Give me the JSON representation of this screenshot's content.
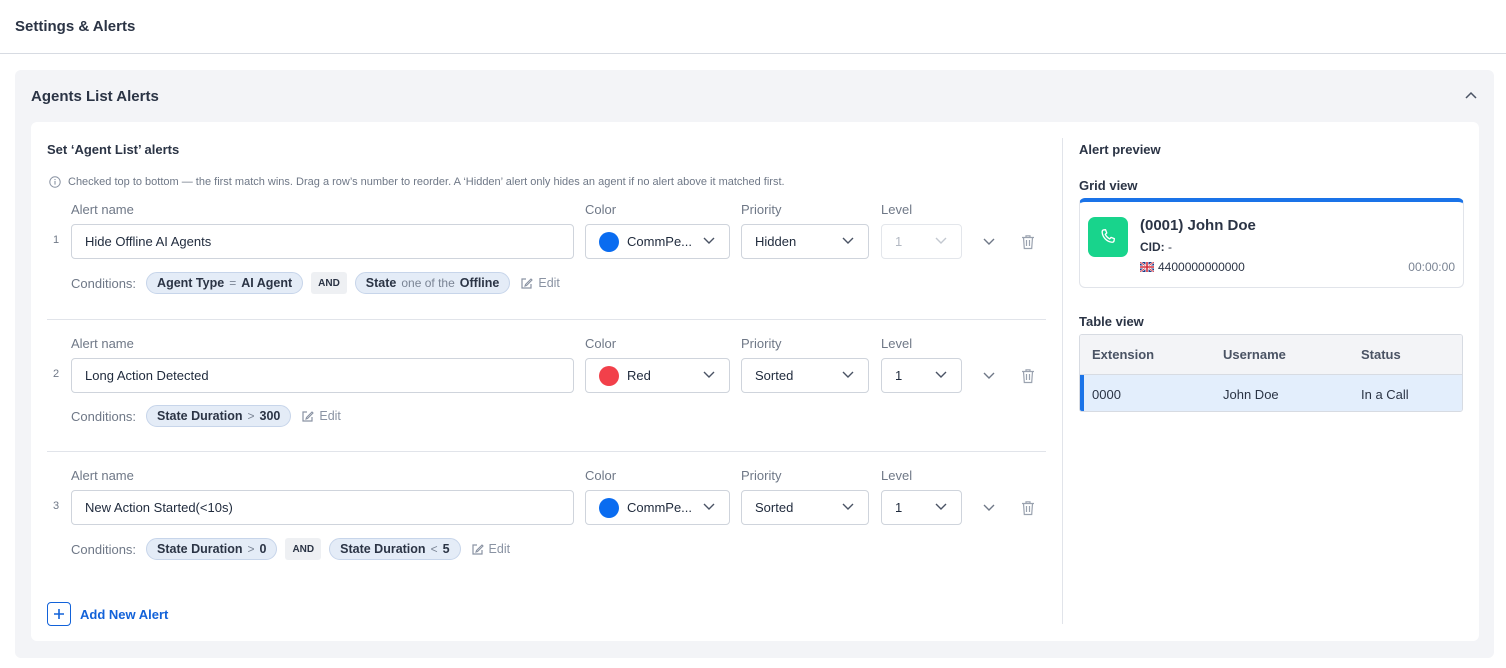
{
  "page": {
    "title": "Settings & Alerts"
  },
  "panel": {
    "title": "Agents List Alerts"
  },
  "editor": {
    "title": "Set ‘Agent List’ alerts",
    "info": "Checked top to bottom — the first match wins. Drag a row’s number to reorder. A ‘Hidden’ alert only hides an agent if no alert above it matched first.",
    "labels": {
      "alert_name": "Alert name",
      "color": "Color",
      "priority": "Priority",
      "level": "Level",
      "conditions": "Conditions:",
      "edit": "Edit",
      "and": "AND"
    },
    "alerts": [
      {
        "index": "1",
        "name": "Hide Offline AI Agents",
        "color_label": "CommPe...",
        "color_hex": "#0a6cf0",
        "priority": "Hidden",
        "level": "1",
        "level_disabled": true,
        "conditions": [
          {
            "field": "Agent Type",
            "op": "=",
            "value": "AI Agent"
          },
          {
            "field": "State",
            "op": "one of the",
            "value": "Offline"
          }
        ]
      },
      {
        "index": "2",
        "name": "Long Action Detected",
        "color_label": "Red",
        "color_hex": "#f2404a",
        "priority": "Sorted",
        "level": "1",
        "level_disabled": false,
        "conditions": [
          {
            "field": "State Duration",
            "op": ">",
            "value": "300"
          }
        ]
      },
      {
        "index": "3",
        "name": "New Action Started(<10s)",
        "color_label": "CommPe...",
        "color_hex": "#0a6cf0",
        "priority": "Sorted",
        "level": "1",
        "level_disabled": false,
        "conditions": [
          {
            "field": "State Duration",
            "op": ">",
            "value": "0"
          },
          {
            "field": "State Duration",
            "op": "<",
            "value": "5"
          }
        ]
      }
    ],
    "add_label": "Add New Alert"
  },
  "preview": {
    "title": "Alert preview",
    "grid_title": "Grid view",
    "agent_name": "(0001) John Doe",
    "cid_label": "CID:",
    "cid_value": "-",
    "phone": "4400000000000",
    "timer": "00:00:00",
    "table_title": "Table view",
    "table": {
      "headers": [
        "Extension",
        "Username",
        "Status"
      ],
      "row": [
        "0000",
        "John Doe",
        "In a Call"
      ]
    }
  },
  "colors": {
    "accent": "#1a73e8",
    "link": "#1262d9",
    "call_green": "#18d48c",
    "selected_row": "#e3eefc"
  }
}
